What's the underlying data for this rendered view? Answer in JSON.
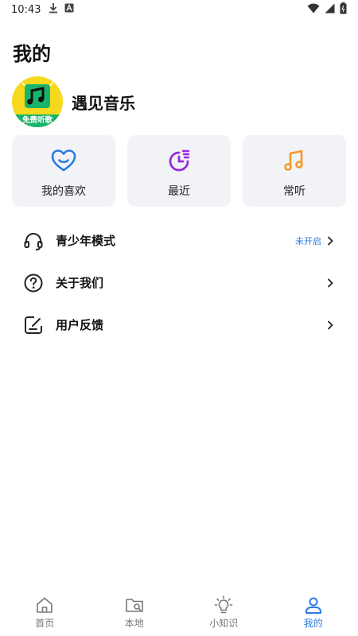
{
  "status_bar": {
    "time": "10:43",
    "left_icons": [
      "download-icon",
      "a-badge-icon"
    ],
    "right_icons": [
      "wifi-icon",
      "signal-icon",
      "battery-icon"
    ]
  },
  "page": {
    "title": "我的"
  },
  "profile": {
    "app_name": "遇见音乐",
    "avatar_ribbon": "免费听歌"
  },
  "cards": [
    {
      "label": "我的喜欢",
      "icon": "heart-icon",
      "color": "#2a7be4"
    },
    {
      "label": "最近",
      "icon": "recent-icon",
      "color": "#9b2bdb"
    },
    {
      "label": "常听",
      "icon": "music-note-icon",
      "color": "#f59a23"
    }
  ],
  "menu": [
    {
      "label": "青少年模式",
      "icon": "headphones-icon",
      "status": "未开启"
    },
    {
      "label": "关于我们",
      "icon": "question-icon",
      "status": ""
    },
    {
      "label": "用户反馈",
      "icon": "feedback-icon",
      "status": ""
    }
  ],
  "bottom_nav": [
    {
      "label": "首页",
      "icon": "home-icon",
      "active": false
    },
    {
      "label": "本地",
      "icon": "local-folder-icon",
      "active": false
    },
    {
      "label": "小知识",
      "icon": "lightbulb-icon",
      "active": false
    },
    {
      "label": "我的",
      "icon": "profile-icon",
      "active": true
    }
  ],
  "colors": {
    "accent": "#2a7be4",
    "card_bg": "#f2f3f7",
    "inactive": "#777777"
  }
}
